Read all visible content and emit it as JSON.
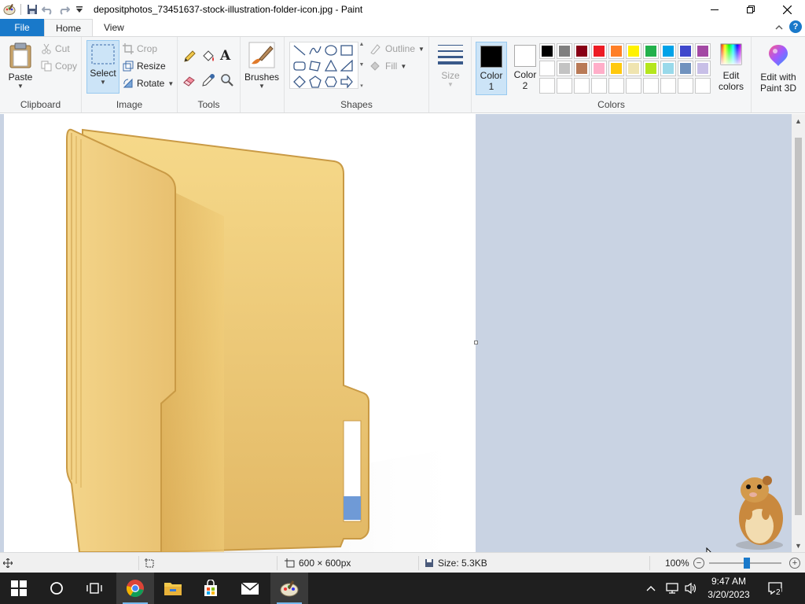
{
  "window": {
    "title": "depositphotos_73451637-stock-illustration-folder-icon.jpg - Paint"
  },
  "quick_access": {
    "icons": [
      "paint-icon",
      "save-icon",
      "undo-icon",
      "redo-icon",
      "customize-icon"
    ]
  },
  "menu": {
    "file": "File",
    "home": "Home",
    "view": "View",
    "active": "Home"
  },
  "ribbon": {
    "clipboard": {
      "label": "Clipboard",
      "paste": "Paste",
      "cut": "Cut",
      "copy": "Copy"
    },
    "image": {
      "label": "Image",
      "select": "Select",
      "crop": "Crop",
      "resize": "Resize",
      "rotate": "Rotate"
    },
    "tools": {
      "label": "Tools",
      "items": [
        "pencil-icon",
        "fill-icon",
        "text-icon",
        "eraser-icon",
        "color-picker-icon",
        "magnifier-icon"
      ]
    },
    "brushes": {
      "label": "Brushes"
    },
    "shapes": {
      "label": "Shapes",
      "outline": "Outline",
      "fill": "Fill"
    },
    "size": {
      "label": "Size"
    },
    "colors": {
      "label": "Colors",
      "color1_line1": "Color",
      "color1_line2": "1",
      "color2_line1": "Color",
      "color2_line2": "2",
      "color1": "#000000",
      "color2": "#ffffff",
      "edit_colors_line1": "Edit",
      "edit_colors_line2": "colors",
      "palette_row1": [
        "#000000",
        "#7f7f7f",
        "#880015",
        "#ed1c24",
        "#ff7f27",
        "#fff200",
        "#22b14c",
        "#00a2e8",
        "#3f48cc",
        "#a349a4"
      ],
      "palette_row2": [
        "#ffffff",
        "#c3c3c3",
        "#b97a57",
        "#ffaec9",
        "#ffc90e",
        "#efe4b0",
        "#b5e61d",
        "#99d9ea",
        "#7092be",
        "#c8bfe7"
      ],
      "palette_row3": [
        "#ffffff",
        "#ffffff",
        "#ffffff",
        "#ffffff",
        "#ffffff",
        "#ffffff",
        "#ffffff",
        "#ffffff",
        "#ffffff",
        "#ffffff"
      ]
    },
    "paint3d": {
      "line1": "Edit with",
      "line2": "Paint 3D"
    }
  },
  "status": {
    "dimensions": "600 × 600px",
    "size": "Size: 5.3KB",
    "zoom": "100%",
    "zoom_level_percent": 100
  },
  "taskbar": {
    "apps": [
      "start-icon",
      "search-icon",
      "task-view-icon",
      "chrome-icon",
      "file-explorer-icon",
      "store-icon",
      "mail-icon",
      "paint-icon"
    ],
    "time": "9:47 AM",
    "date": "3/20/2023",
    "notifications": "2"
  }
}
